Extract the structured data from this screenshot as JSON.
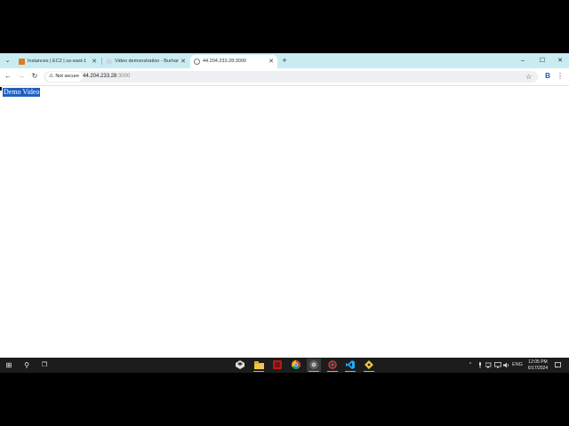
{
  "browser": {
    "tabs": [
      {
        "title": "Instances | EC2 | us-east-1",
        "favicon": "aws-favicon-icon",
        "color": "#e07a1f",
        "active": false
      },
      {
        "title": "Video demonstration - Burhan",
        "favicon": "loading-icon",
        "color": "#c8d6e6",
        "active": false
      },
      {
        "title": "44.204.233.28:3000",
        "favicon": "globe-icon",
        "color": "#777777",
        "active": true
      }
    ],
    "new_tab_glyph": "+",
    "window_controls": {
      "minimize": "–",
      "maximize": "☐",
      "close": "✕"
    },
    "toolbar": {
      "back_glyph": "←",
      "forward_glyph": "→",
      "reload_glyph": "↻",
      "security_label": "Not secure",
      "url_host": "44.204.233.28",
      "url_port": ":3000",
      "star_glyph": "☆",
      "profile_glyph": "B",
      "menu_glyph": "⋮"
    }
  },
  "page": {
    "link_text": "Demo Video",
    "selection_color": "#1f5fbf"
  },
  "taskbar": {
    "start_glyph": "⊞",
    "search_glyph": "⚲",
    "taskview_glyph": "❐",
    "apps": [
      "unity-icon",
      "file-explorer-icon",
      "filezilla-icon",
      "chrome-icon",
      "chrome-dev-icon",
      "screen-recorder-icon",
      "vscode-icon",
      "git-icon"
    ],
    "tray": {
      "chevron": "^",
      "language": "ENG",
      "time": "12:05 PM",
      "date": "6/17/2024"
    }
  }
}
